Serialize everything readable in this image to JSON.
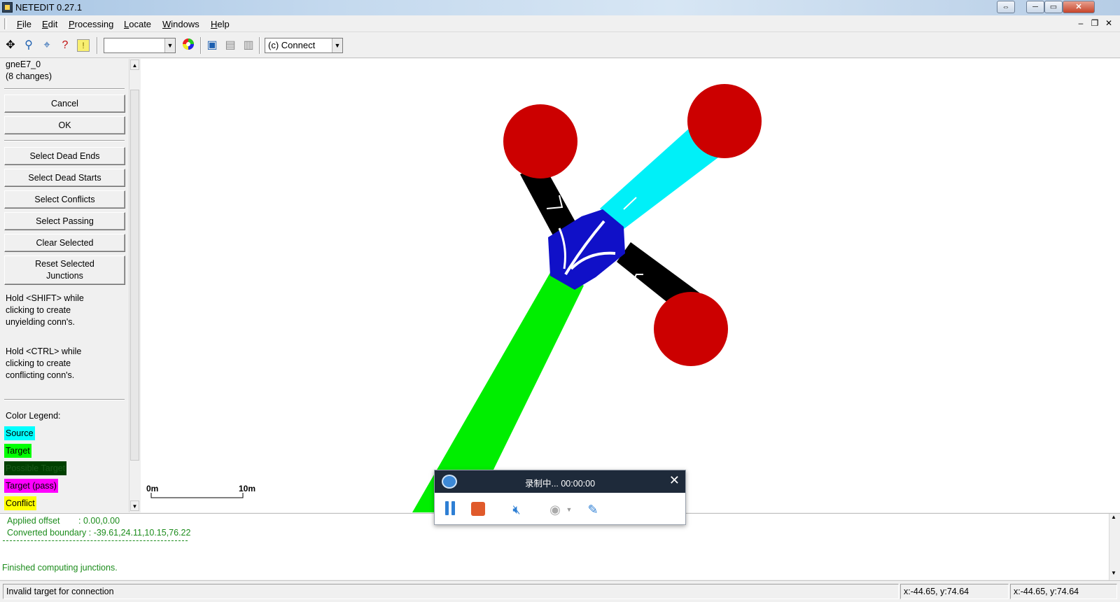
{
  "window": {
    "title": "NETEDIT 0.27.1"
  },
  "menu": [
    {
      "label": "File",
      "key": "F",
      "rest": "ile"
    },
    {
      "label": "Edit",
      "key": "E",
      "rest": "dit"
    },
    {
      "label": "Processing",
      "key": "P",
      "rest": "rocessing"
    },
    {
      "label": "Locate",
      "key": "L",
      "rest": "ocate"
    },
    {
      "label": "Windows",
      "key": "W",
      "rest": "indows"
    },
    {
      "label": "Help",
      "key": "H",
      "rest": "elp"
    }
  ],
  "toolbar": {
    "view_combo_value": "",
    "mode_combo_value": "(c) Connect"
  },
  "sidebar": {
    "lane_id": "gneE7_0",
    "changes": "(8 changes)",
    "cancel": "Cancel",
    "ok": "OK",
    "buttons": [
      "Select Dead Ends",
      "Select Dead Starts",
      "Select Conflicts",
      "Select Passing",
      "Clear Selected"
    ],
    "reset_line1": "Reset Selected",
    "reset_line2": "Junctions",
    "shift_hint": [
      "Hold <SHIFT> while",
      "clicking to create",
      "unyielding conn's."
    ],
    "ctrl_hint": [
      "Hold <CTRL> while",
      "clicking to create",
      "conflicting conn's."
    ],
    "legend_title": "Color Legend:",
    "legend": [
      {
        "label": "Source",
        "color": "#00ffff",
        "text_color": "#000000"
      },
      {
        "label": "Target",
        "color": "#00ff00",
        "text_color": "#000000"
      },
      {
        "label": "Possible Target",
        "color": "#004000",
        "text_color": "#1a5a1a"
      },
      {
        "label": "Target (pass)",
        "color": "#ff00ff",
        "text_color": "#000000"
      },
      {
        "label": "Conflict",
        "color": "#ffff00",
        "text_color": "#000000"
      }
    ]
  },
  "canvas": {
    "scale_start": "0m",
    "scale_end": "10m",
    "colors": {
      "junction": "#1010c8",
      "dead_end": "#cc0000",
      "source": "#00f0f8",
      "target": "#00ee00",
      "lane": "#000000"
    }
  },
  "log": {
    "offset_label": "Applied offset",
    "offset_value": ": 0.00,0.00",
    "boundary": "Converted boundary : -39.61,24.11,10.15,76.22",
    "finished": "Finished computing junctions."
  },
  "status": {
    "message": "Invalid target for connection",
    "coord1": "x:-44.65, y:74.64",
    "coord2": "x:-44.65, y:74.64"
  },
  "recorder": {
    "title": "录制中... 00:00:00"
  }
}
